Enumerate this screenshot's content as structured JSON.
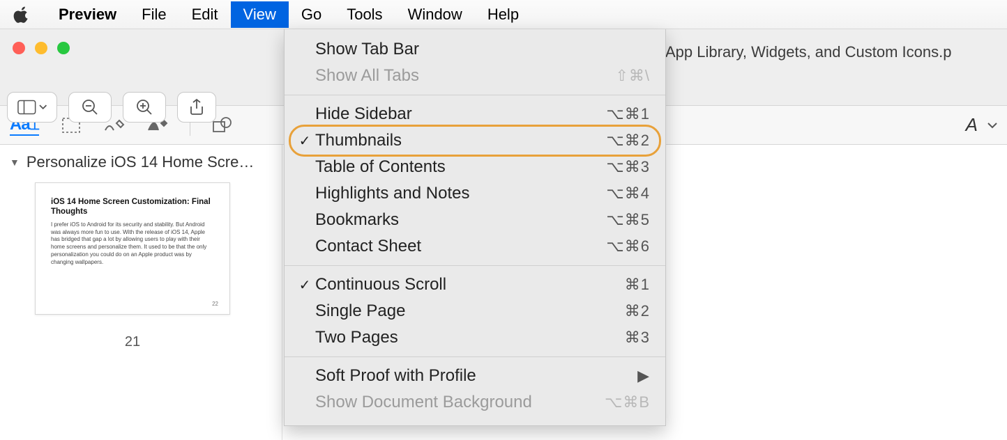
{
  "menubar": {
    "app": "Preview",
    "items": [
      "File",
      "Edit",
      "View",
      "Go",
      "Tools",
      "Window",
      "Help"
    ],
    "open_index": 2
  },
  "window": {
    "title_fragment": "App Library, Widgets, and Custom Icons.p"
  },
  "sidebar": {
    "doc_title": "Personalize iOS 14 Home Scre…",
    "page_number": "21",
    "thumb": {
      "heading": "iOS 14 Home Screen Customization: Final Thoughts",
      "body": "I prefer iOS to Android for its security and stability. But Android was always more fun to use. With the release of iOS 14, Apple has bridged that gap a lot by allowing users to play with their home screens and personalize them. It used to be that the only personalization you could do on an Apple product was by changing wallpapers.",
      "page_num_small": "22"
    }
  },
  "markup": {
    "font_label": "A"
  },
  "dropdown": {
    "groups": [
      [
        {
          "label": "Show Tab Bar",
          "shortcut": "",
          "checked": false,
          "disabled": false
        },
        {
          "label": "Show All Tabs",
          "shortcut": "⇧⌘\\",
          "checked": false,
          "disabled": true
        }
      ],
      [
        {
          "label": "Hide Sidebar",
          "shortcut": "⌥⌘1",
          "checked": false,
          "disabled": false
        },
        {
          "label": "Thumbnails",
          "shortcut": "⌥⌘2",
          "checked": true,
          "disabled": false,
          "highlight": true
        },
        {
          "label": "Table of Contents",
          "shortcut": "⌥⌘3",
          "checked": false,
          "disabled": false
        },
        {
          "label": "Highlights and Notes",
          "shortcut": "⌥⌘4",
          "checked": false,
          "disabled": false
        },
        {
          "label": "Bookmarks",
          "shortcut": "⌥⌘5",
          "checked": false,
          "disabled": false
        },
        {
          "label": "Contact Sheet",
          "shortcut": "⌥⌘6",
          "checked": false,
          "disabled": false
        }
      ],
      [
        {
          "label": "Continuous Scroll",
          "shortcut": "⌘1",
          "checked": true,
          "disabled": false
        },
        {
          "label": "Single Page",
          "shortcut": "⌘2",
          "checked": false,
          "disabled": false
        },
        {
          "label": "Two Pages",
          "shortcut": "⌘3",
          "checked": false,
          "disabled": false
        }
      ],
      [
        {
          "label": "Soft Proof with Profile",
          "shortcut": "▶",
          "checked": false,
          "disabled": false,
          "submenu": true
        },
        {
          "label": "Show Document Background",
          "shortcut": "⌥⌘B",
          "checked": false,
          "disabled": true
        }
      ]
    ]
  }
}
